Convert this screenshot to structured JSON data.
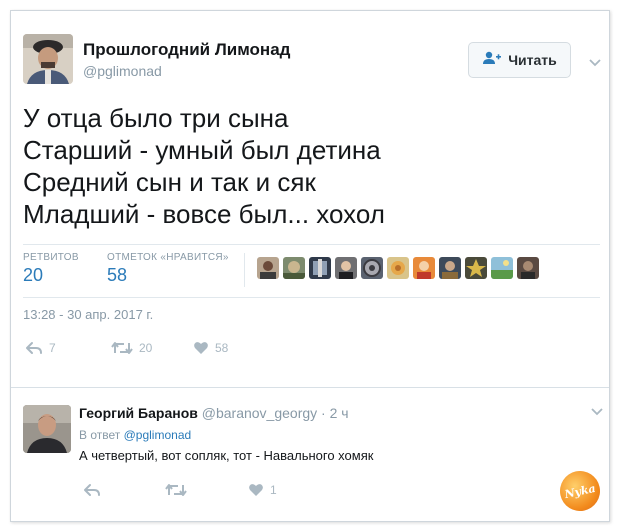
{
  "tweet": {
    "author_name": "Прошлогодний Лимонад",
    "author_handle": "@pglimonad",
    "follow_label": "Читать",
    "text_lines": [
      "У отца было три сына",
      "Старший - умный был детина",
      "Средний сын и так и сяк",
      "Младший - вовсе был... хохол"
    ],
    "stats": {
      "retweets_label": "РЕТВИТОВ",
      "retweets_count": "20",
      "likes_label": "ОТМЕТОК «НРАВИТСЯ»",
      "likes_count": "58"
    },
    "timestamp": "13:28 - 30 апр. 2017 г.",
    "actions": {
      "reply_count": "7",
      "retweet_count": "20",
      "like_count": "58"
    }
  },
  "reply": {
    "author_name": "Георгий Баранов",
    "author_handle": "@baranov_georgy",
    "time_ago": "· 2 ч",
    "in_reply_prefix": "В ответ",
    "in_reply_mention": "@pglimonad",
    "text": "А четвертый, вот сопляк, тот - Навального хомяк",
    "actions": {
      "like_count": "1"
    }
  },
  "watermark_text": "Nyka",
  "colors": {
    "link_blue": "#2b7bb9",
    "muted_gray": "#8899a6",
    "icon_gray": "#aab8c2",
    "text_dark": "#14171a"
  }
}
